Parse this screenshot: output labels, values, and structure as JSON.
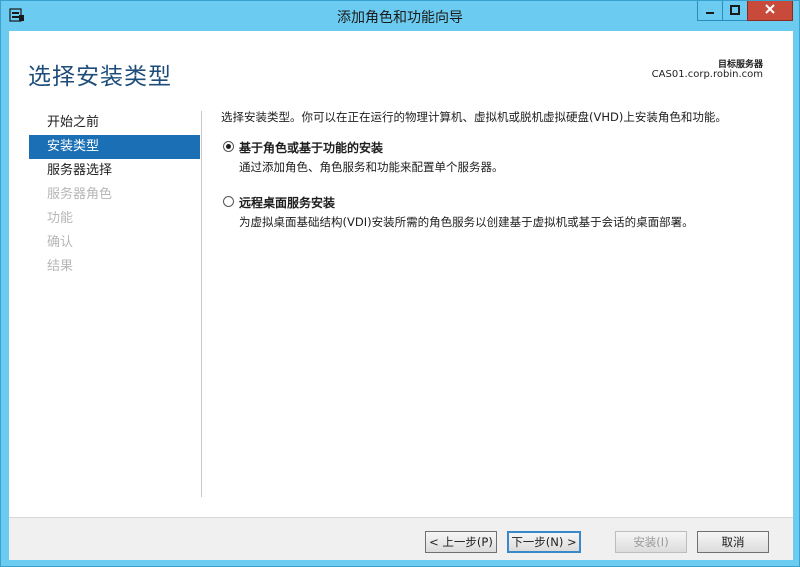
{
  "window": {
    "title": "添加角色和功能向导",
    "buttons": {
      "minimize": "minimize-icon",
      "maximize": "maximize-icon",
      "close": "close-icon"
    }
  },
  "header": {
    "page_title": "选择安装类型",
    "dest_label": "目标服务器",
    "dest_server": "CAS01.corp.robin.com"
  },
  "nav": {
    "items": [
      {
        "label": "开始之前",
        "state": "normal"
      },
      {
        "label": "安装类型",
        "state": "active"
      },
      {
        "label": "服务器选择",
        "state": "normal"
      },
      {
        "label": "服务器角色",
        "state": "disabled"
      },
      {
        "label": "功能",
        "state": "disabled"
      },
      {
        "label": "确认",
        "state": "disabled"
      },
      {
        "label": "结果",
        "state": "disabled"
      }
    ]
  },
  "main": {
    "intro": "选择安装类型。你可以在正在运行的物理计算机、虚拟机或脱机虚拟硬盘(VHD)上安装角色和功能。",
    "options": [
      {
        "title": "基于角色或基于功能的安装",
        "desc": "通过添加角色、角色服务和功能来配置单个服务器。",
        "checked": true
      },
      {
        "title": "远程桌面服务安装",
        "desc": "为虚拟桌面基础结构(VDI)安装所需的角色服务以创建基于虚拟机或基于会话的桌面部署。",
        "checked": false
      }
    ]
  },
  "footer": {
    "prev": "< 上一步(P)",
    "next": "下一步(N) >",
    "install": "安装(I)",
    "cancel": "取消"
  },
  "colors": {
    "titlebar": "#6ccbf0",
    "accent": "#1b6fb5",
    "close": "#c74a3b"
  }
}
